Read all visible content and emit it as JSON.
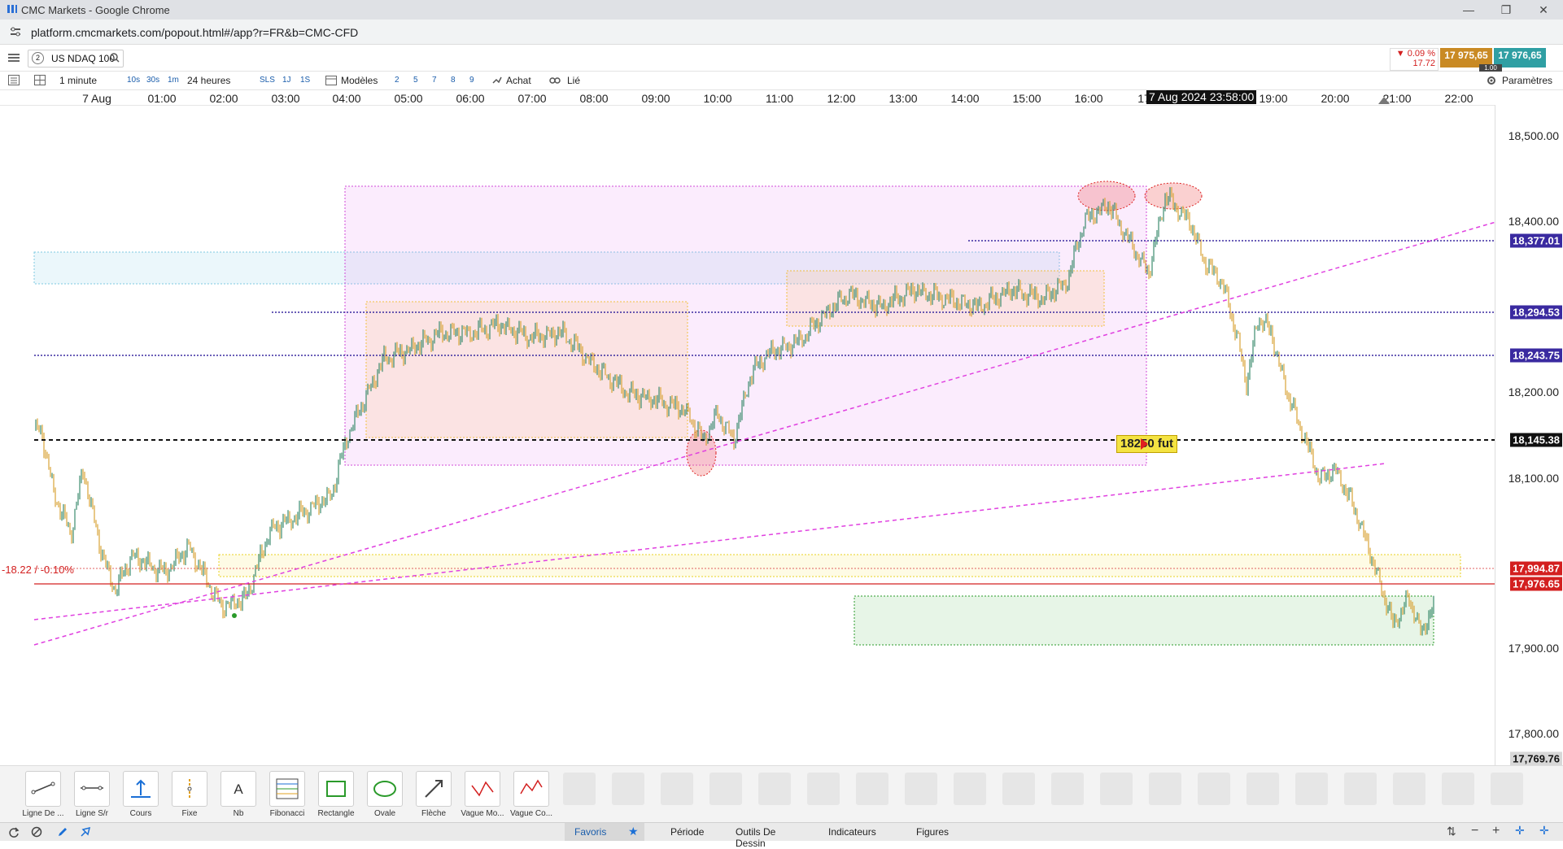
{
  "window": {
    "title": "CMC Markets - Google Chrome",
    "url": "platform.cmcmarkets.com/popout.html#/app?r=FR&b=CMC-CFD"
  },
  "header": {
    "instrument_index": "2",
    "instrument": "US NDAQ 100",
    "change_pct": "▼ 0.09 %",
    "change_abs": "17.72",
    "sell_price": "17 975,65",
    "buy_price": "17 976,65",
    "spread": "1.00"
  },
  "toolbar": {
    "interval": "1 minute",
    "quick_intervals": [
      "10s",
      "30s",
      "1m"
    ],
    "period": "24 heures",
    "sls": "SLS",
    "one_day": "1J",
    "one_week": "1S",
    "models": "Modèles",
    "counts": [
      "2",
      "5",
      "7",
      "8",
      "9"
    ],
    "buy": "Achat",
    "linked": "Lié",
    "settings": "Paramètres"
  },
  "time_axis": {
    "labels": [
      "7 Aug",
      "01:00",
      "02:00",
      "03:00",
      "04:00",
      "05:00",
      "06:00",
      "07:00",
      "08:00",
      "09:00",
      "10:00",
      "11:00",
      "12:00",
      "13:00",
      "14:00",
      "15:00",
      "16:00",
      "17",
      "19:00",
      "20:00",
      "21:00",
      "22:00"
    ],
    "crosshair_label": "7 Aug 2024 23:58:00"
  },
  "price_axis": {
    "ticks": [
      "18,500.00",
      "18,400.00",
      "18,200.00",
      "18,100.00",
      "17,900.00",
      "17,800.00"
    ],
    "tags": {
      "line_1": "18,377.01",
      "line_2": "18,294.53",
      "line_3": "18,243.75",
      "line_4": "18,145.38",
      "prev_close": "17,994.87",
      "current": "17,976.65",
      "low": "17,769.76"
    }
  },
  "chart": {
    "change_label": "-18.22 / -0.10%",
    "annotation": "18250 fut",
    "colors": {
      "candle_up": "#3c8c6e",
      "candle_down": "#d9a437",
      "trendline": "#e040e0",
      "horizontal": "#3a2aa0",
      "current": "#d32020"
    }
  },
  "draw_tools": [
    {
      "label": "Ligne De ...",
      "icon": "line-icon"
    },
    {
      "label": "Ligne S/r",
      "icon": "sr-line-icon"
    },
    {
      "label": "Cours",
      "icon": "price-icon"
    },
    {
      "label": "Fixe",
      "icon": "fixed-icon"
    },
    {
      "label": "Nb",
      "icon": "text-icon"
    },
    {
      "label": "Fibonacci",
      "icon": "fibonacci-icon"
    },
    {
      "label": "Rectangle",
      "icon": "rectangle-icon"
    },
    {
      "label": "Ovale",
      "icon": "oval-icon"
    },
    {
      "label": "Flèche",
      "icon": "arrow-icon"
    },
    {
      "label": "Vague Mo...",
      "icon": "wave-icon"
    },
    {
      "label": "Vague Co...",
      "icon": "corrective-wave-icon"
    }
  ],
  "bottom_tabs": {
    "favorites": "Favoris",
    "period": "Période",
    "drawing": "Outils De Dessin",
    "indicators": "Indicateurs",
    "figures": "Figures"
  }
}
